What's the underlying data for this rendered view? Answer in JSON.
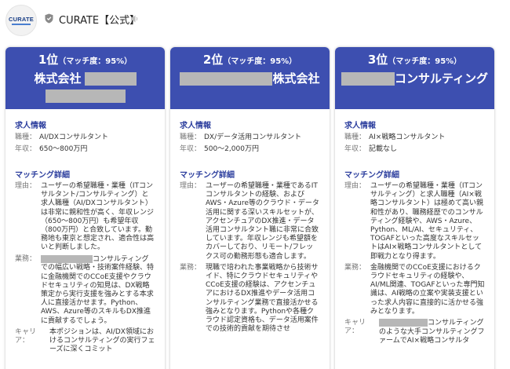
{
  "header": {
    "app_name": "CURATE【公式】",
    "avatar_logo": "CURATE",
    "icons": {
      "verified": "shield-icon",
      "mute": "speaker-icon"
    }
  },
  "colors": {
    "card_header": "#3d4fb0",
    "section_title": "#2d3f9e",
    "redaction": "#b7b7b7"
  },
  "labels": {
    "job_info": "求人情報",
    "role": "職種：",
    "salary": "年収：",
    "matching": "マッチング詳細",
    "reason": "理由：",
    "business": "業務：",
    "career": "キャリア："
  },
  "cards": [
    {
      "rank": "1位",
      "score": "（マッチ度：95%）",
      "company_prefix": "株式会社",
      "company_suffix": "",
      "role": "AI/DXコンサルタント",
      "salary": "650〜800万円",
      "reason": "ユーザーの希望職種・業種（ITコンサルタント/コンサルティング）と求人職種（AI/DXコンサルタント）は非常に親和性が高く、年収レンジ（650〜800万円）も希望年収（800万円）と合致しています。勤務地も東京と想定され、適合性は高いと判断しました。",
      "business": "コンサルティングでの幅広い戦略・技術案件経験、特に金融機関でのCCoE支援やクラウドセキュリティの知見は、DX戦略策定から実行支援を強みとする本求人に直接活かせます。Python、AWS、Azure等のスキルもDX推進に貢献するでしょう。",
      "career": "本ポジションは、AI/DX領域におけるコンサルティングの実行フェーズに深くコミット"
    },
    {
      "rank": "2位",
      "score": "（マッチ度：95%）",
      "company_prefix": "",
      "company_suffix": "株式会社",
      "role": "DX/データ活用コンサルタント",
      "salary": "500〜2,000万円",
      "reason": "ユーザーの希望職種・業種であるITコンサルタントの経験、およびAWS・Azure等のクラウド・データ活用に関する深いスキルセットが、アクセンチュアのDX推進・データ活用コンサルタント職に非常に合致しています。年収レンジも希望額をカバーしており、リモート/フレックス可の勤務形態も適合します。",
      "business": "現職で培われた事業戦略から技術サイド、特にクラウドセキュリティやCCoE支援の経験は、アクセンチュアにおけるDX推進やデータ活用コンサルティング業務で直接活かせる強みとなります。Pythonや各種クラウド認定資格も、データ活用案件での技術的貢献を期待させ",
      "career": ""
    },
    {
      "rank": "3位",
      "score": "（マッチ度：95%）",
      "company_prefix": "",
      "company_suffix": "コンサルティング",
      "role": "AI×戦略コンサルタント",
      "salary": "記載なし",
      "reason": "ユーザーの希望職種・業種（ITコンサルティング）と求人職種（AI×戦略コンサルタント）は極めて高い親和性があり、職務経歴でのコンサルティング経験や、AWS・Azure、Python、ML/AI、セキュリティ、TOGAFといった高度なスキルセットはAI×戦略コンサルタントとして即戦力となり得ます。",
      "business": "金融機関でのCCoE支援におけるクラウドセキュリティの経験や、AI/ML関連、TOGAFといった専門知識は、AI戦略の立案や実装支援といった求人内容に直接的に活かせる強みとなります。",
      "career": "コンサルティングのような大手コンサルティングファームでAI×戦略コンサルタ"
    }
  ]
}
